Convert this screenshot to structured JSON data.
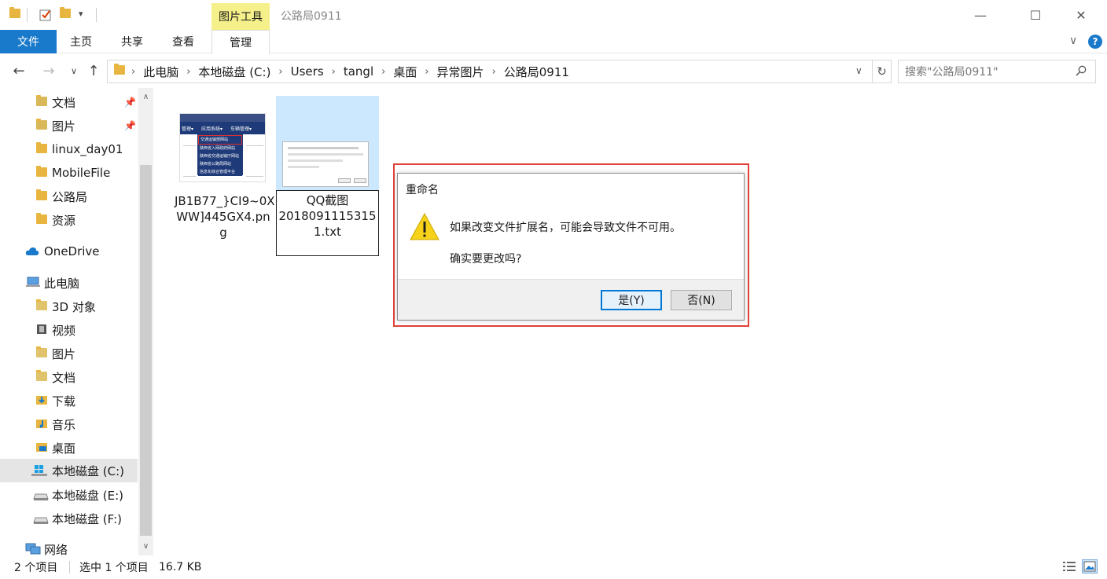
{
  "titlebar": {
    "picture_tools_label": "图片工具",
    "window_title": "公路局0911",
    "minimize": "—",
    "maximize": "☐",
    "close": "✕"
  },
  "ribbon": {
    "tabs": [
      {
        "label": "文件"
      },
      {
        "label": "主页"
      },
      {
        "label": "共享"
      },
      {
        "label": "查看"
      },
      {
        "label": "管理"
      }
    ],
    "help": "?"
  },
  "address": {
    "crumbs": [
      "此电脑",
      "本地磁盘 (C:)",
      "Users",
      "tangl",
      "桌面",
      "异常图片",
      "公路局0911"
    ],
    "search_placeholder": "搜索\"公路局0911\""
  },
  "sidebar": {
    "items": [
      {
        "label": "文档",
        "icon": "document-folder-icon",
        "pinned": true
      },
      {
        "label": "图片",
        "icon": "pictures-folder-icon",
        "pinned": true
      },
      {
        "label": "linux_day01",
        "icon": "folder-icon"
      },
      {
        "label": "MobileFile",
        "icon": "folder-icon"
      },
      {
        "label": "公路局",
        "icon": "folder-icon"
      },
      {
        "label": "资源",
        "icon": "folder-icon"
      },
      {
        "label": "OneDrive",
        "icon": "onedrive-cloud-icon"
      },
      {
        "label": "此电脑",
        "icon": "computer-icon"
      },
      {
        "label": "3D 对象",
        "icon": "3d-objects-icon"
      },
      {
        "label": "视频",
        "icon": "videos-icon"
      },
      {
        "label": "图片",
        "icon": "pictures-icon"
      },
      {
        "label": "文档",
        "icon": "documents-icon"
      },
      {
        "label": "下载",
        "icon": "downloads-icon"
      },
      {
        "label": "音乐",
        "icon": "music-icon"
      },
      {
        "label": "桌面",
        "icon": "desktop-icon"
      },
      {
        "label": "本地磁盘 (C:)",
        "icon": "windows-drive-icon",
        "selected": true
      },
      {
        "label": "本地磁盘 (E:)",
        "icon": "drive-icon"
      },
      {
        "label": "本地磁盘 (F:)",
        "icon": "drive-icon"
      },
      {
        "label": "网络",
        "icon": "network-icon"
      }
    ]
  },
  "files": [
    {
      "name_line1": "JB1B77_}CI9~0X",
      "name_line2": "WW]445GX4.pn",
      "name_line3": "g"
    },
    {
      "name_line1": "QQ截图",
      "name_line2": "2018091115315",
      "name_line3": "1.txt"
    }
  ],
  "thumbnail_menu": {
    "top_items": [
      "管理▾",
      "应用系统▾",
      "车辆管理▾"
    ],
    "items": [
      "交通运输部网站",
      "陕西省入网政府网站",
      "陕西省交通运输厅网站",
      "陕西省公路局网站",
      "信息化综合管理平台"
    ]
  },
  "dialog": {
    "title": "重命名",
    "message": "如果改变文件扩展名，可能会导致文件不可用。",
    "question": "确实要更改吗?",
    "yes_label": "是(Y)",
    "no_label": "否(N)"
  },
  "status": {
    "item_count": "2 个项目",
    "selection": "选中 1 个项目",
    "size": "16.7 KB"
  },
  "colors": {
    "accent": "#1979ca",
    "picture_tools": "#f5f08a",
    "highlight_border": "#e0403a",
    "selected_file": "#cce8ff"
  }
}
